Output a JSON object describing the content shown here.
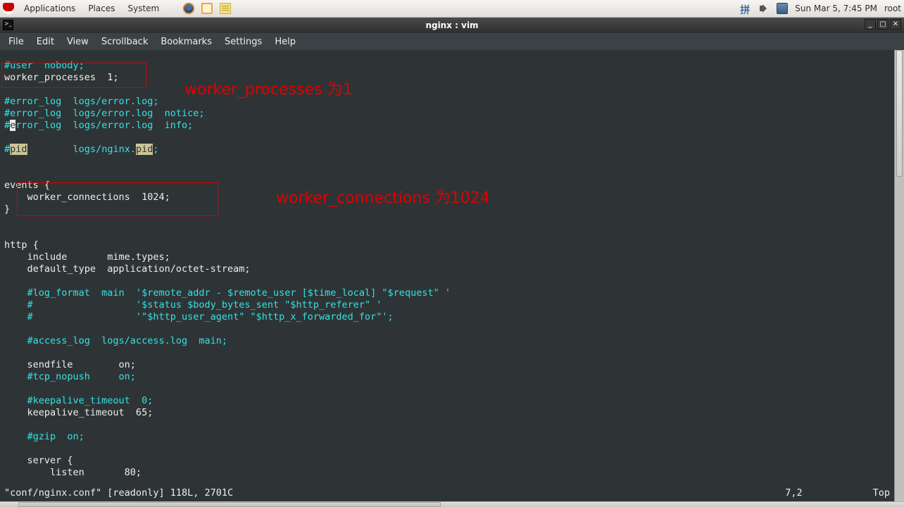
{
  "panel": {
    "menus": {
      "applications": "Applications",
      "places": "Places",
      "system": "System"
    },
    "clock": "Sun Mar  5,  7:45 PM",
    "user": "root"
  },
  "window": {
    "title": "nginx : vim",
    "menubar": {
      "file": "File",
      "edit": "Edit",
      "view": "View",
      "scrollback": "Scrollback",
      "bookmarks": "Bookmarks",
      "settings": "Settings",
      "help": "Help"
    }
  },
  "annotations": {
    "wp_label": "worker_processes 为1",
    "wc_label": "worker_connections 为1024"
  },
  "code": {
    "l01a": "#user  nobody;",
    "l02a": "worker_processes  1;",
    "l04a": "#error_log  logs/error.log;",
    "l05a": "#error_log  logs/error.log  notice;",
    "l06a": "#",
    "l06b": "e",
    "l06c": "rror_log  logs/error.log  info;",
    "l08a": "#",
    "l08b": "pid",
    "l08c": "        logs/nginx.",
    "l08d": "pid",
    "l08e": ";",
    "l11a": "events {",
    "l12a": "    worker_connections  1024;",
    "l13a": "}",
    "l16a": "http {",
    "l17a": "    include       mime.types;",
    "l18a": "    default_type  application/octet-stream;",
    "l20a": "    #log_format  main  '$remote_addr - $remote_user [$time_local] \"$request\" '",
    "l21a": "    #                  '$status $body_bytes_sent \"$http_referer\" '",
    "l22a": "    #                  '\"$http_user_agent\" \"$http_x_forwarded_for\"';",
    "l24a": "    #access_log  logs/access.log  main;",
    "l26a": "    sendfile        on;",
    "l27a": "    #tcp_nopush     on;",
    "l29a": "    #keepalive_timeout  0;",
    "l30a": "    keepalive_timeout  65;",
    "l32a": "    #gzip  on;",
    "l34a": "    server {",
    "l35a": "        listen       80;"
  },
  "status": {
    "left": "\"conf/nginx.conf\" [readonly] 118L, 2701C",
    "pos": "7,2",
    "right": "Top"
  }
}
